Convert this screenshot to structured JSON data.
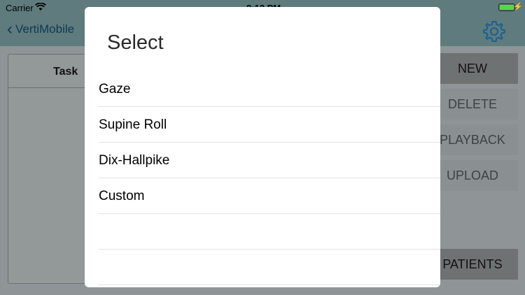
{
  "status_bar": {
    "carrier": "Carrier",
    "time": "8:12 PM",
    "wifi_icon": "wifi-icon",
    "battery_icon": "battery-icon",
    "charging_icon": "bolt-icon",
    "battery_color": "#5ad44a"
  },
  "nav": {
    "back_label": "VertiMobile",
    "back_icon": "chevron-left-icon",
    "settings_icon": "gear-icon",
    "accent_color": "#1a73b8"
  },
  "table": {
    "header": "Task"
  },
  "side_buttons": {
    "new": "NEW",
    "delete": "DELETE",
    "playback": "PLAYBACK",
    "upload": "UPLOAD",
    "patients": "PATIENTS"
  },
  "modal": {
    "title": "Select",
    "options": [
      "Gaze",
      "Supine Roll",
      "Dix-Hallpike",
      "Custom",
      "",
      ""
    ]
  }
}
